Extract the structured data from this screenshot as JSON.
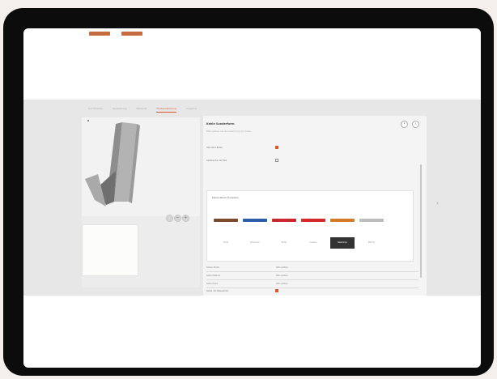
{
  "colors": {
    "accent": "#d9572b",
    "frame": "#0c0c0c",
    "band": "#e7e7e7"
  },
  "nav": {
    "tabs": [
      {
        "label": "Dachhaube",
        "active": false
      },
      {
        "label": "Gestaltung",
        "active": false
      },
      {
        "label": "Material",
        "active": false
      },
      {
        "label": "Firstausbildung",
        "active": true
      },
      {
        "label": "Angebot",
        "active": false
      }
    ]
  },
  "viewer": {
    "zoom_out": "−",
    "zoom_in": "+",
    "reset": ""
  },
  "panel": {
    "title": "Kehle Sonderform",
    "subtitle": "Bitte wählen Sie die Ausführung der Kehle",
    "prev": "‹",
    "next": "›",
    "option1_label": "Standard-Kehle",
    "option2_label": "Kehlbleche mit Falz",
    "manufacturers_title": "Kehlen-Blech-Hersteller",
    "logos": [
      {
        "name": "Prefa",
        "color": "#7a4a2a"
      },
      {
        "name": "Rheinzink",
        "color": "#2a5ea8"
      },
      {
        "name": "Braas",
        "color": "#c8282e"
      },
      {
        "name": "Creaton",
        "color": "#d42a2a"
      },
      {
        "name": "Nelskamp",
        "color": "#d27a2a"
      },
      {
        "name": "Eternit",
        "color": "#bdbdbd"
      }
    ],
    "fields": [
      {
        "label": "Kehlen-Breite",
        "value": "bitte wählen"
      },
      {
        "label": "Kehle Material",
        "value": "bitte wählen"
      },
      {
        "label": "Kehle Farbe",
        "value": "bitte wählen"
      }
    ],
    "last_option_label": "Kehle mit Wasserfalz"
  },
  "mid_chevron": "›"
}
